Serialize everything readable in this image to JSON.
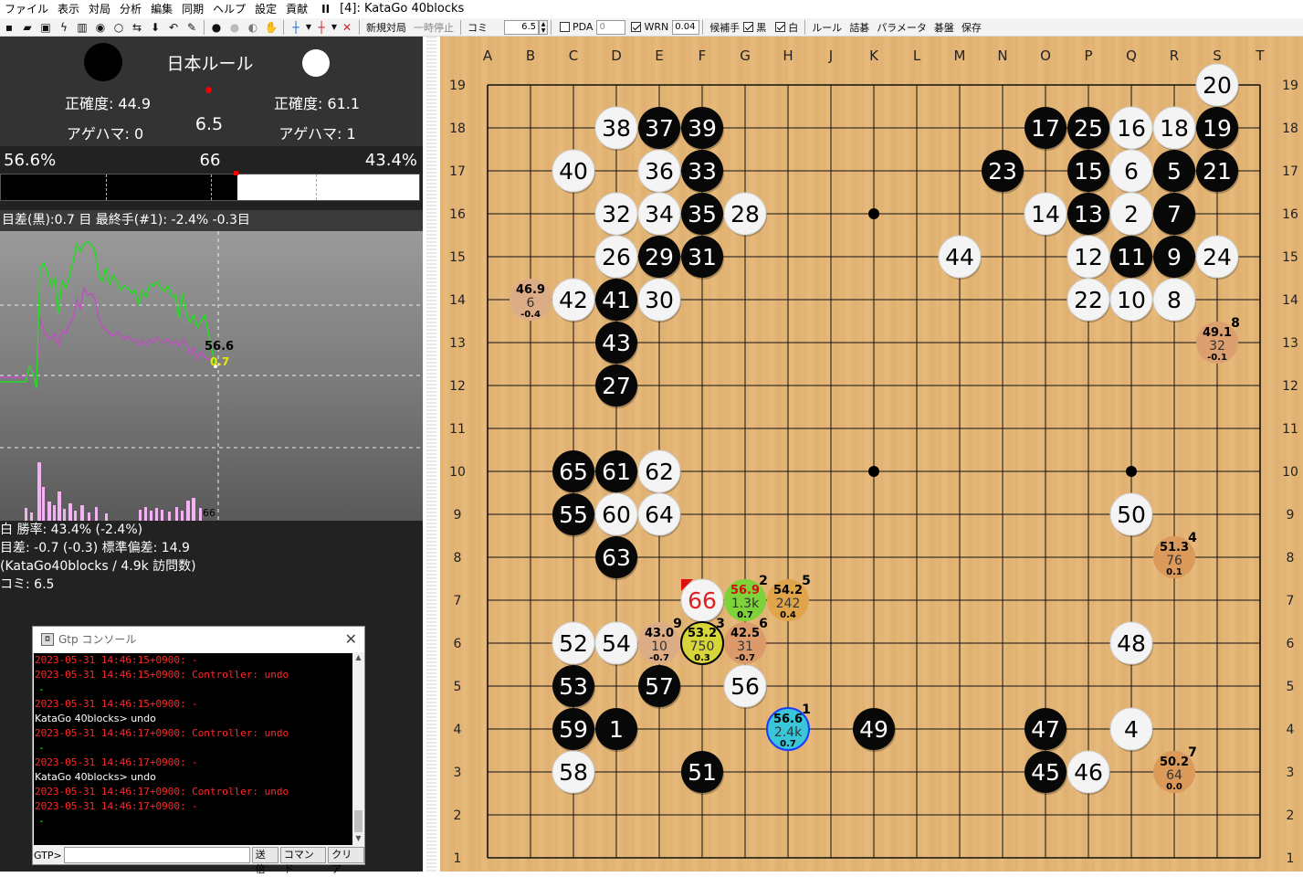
{
  "menu": {
    "items": [
      "ファイル",
      "表示",
      "対局",
      "分析",
      "編集",
      "同期",
      "ヘルプ",
      "設定",
      "貢献"
    ],
    "pause_symbol": "II",
    "window_title": "[4]: KataGo 40blocks"
  },
  "toolbar": {
    "new_game": "新規対局",
    "pause": "一時停止",
    "komi_label": "コミ",
    "komi_value": "6.5",
    "pda_label": "PDA",
    "pda_value": "0",
    "wrn_label": "WRN",
    "wrn_value": "0.04",
    "candidate_label": "候補手",
    "black_label": "黒",
    "white_label": "白",
    "rules": "ルール",
    "tsumego": "詰碁",
    "params": "パラメータ",
    "board": "碁盤",
    "save": "保存"
  },
  "score": {
    "rule": "日本ルール",
    "black_accuracy": "正確度: 44.9",
    "white_accuracy": "正確度: 61.1",
    "black_captures": "アゲハマ: 0",
    "white_captures": "アゲハマ: 1",
    "komi": "6.5"
  },
  "winrate": {
    "black_pct": "56.6%",
    "move_num": "66",
    "white_pct": "43.4%",
    "black_fraction": 0.566
  },
  "info_line": "目差(黒):0.7 目 最終手(#1): -2.4% -0.3目",
  "graph": {
    "last_winrate": "56.6",
    "last_score": "0.7",
    "last_move": "66"
  },
  "stats": [
    "白 勝率: 43.4% (-2.4%)",
    "目差: -0.7 (-0.3) 標準偏差: 14.9",
    "(KataGo40blocks / 4.9k 訪問数)",
    "コミ: 6.5"
  ],
  "console": {
    "title": "Gtp コンソール",
    "lines": [
      {
        "t": "red",
        "s": "2023-05-31 14:46:15+0900: -"
      },
      {
        "t": "red",
        "s": "2023-05-31 14:46:15+0900: Controller: undo"
      },
      {
        "t": "green",
        "s": "-"
      },
      {
        "t": "red",
        "s": "2023-05-31 14:46:15+0900: -"
      },
      {
        "t": "white",
        "s": "KataGo 40blocks> undo"
      },
      {
        "t": "red",
        "s": "2023-05-31 14:46:17+0900: Controller: undo"
      },
      {
        "t": "green",
        "s": "-"
      },
      {
        "t": "red",
        "s": "2023-05-31 14:46:17+0900: -"
      },
      {
        "t": "white",
        "s": "KataGo 40blocks> undo"
      },
      {
        "t": "red",
        "s": "2023-05-31 14:46:17+0900: Controller: undo"
      },
      {
        "t": "red",
        "s": "2023-05-31 14:46:17+0900: -"
      },
      {
        "t": "green",
        "s": "-"
      }
    ],
    "prompt": "GTP>",
    "send": "送信",
    "command": "コマンド",
    "clear": "クリア"
  },
  "board": {
    "cols": [
      "A",
      "B",
      "C",
      "D",
      "E",
      "F",
      "G",
      "H",
      "J",
      "K",
      "L",
      "M",
      "N",
      "O",
      "P",
      "Q",
      "R",
      "S",
      "T"
    ],
    "rows": [
      "19",
      "18",
      "17",
      "16",
      "15",
      "14",
      "13",
      "12",
      "11",
      "10",
      "9",
      "8",
      "7",
      "6",
      "5",
      "4",
      "3",
      "2",
      "1"
    ],
    "stones": [
      {
        "c": "S",
        "r": 19,
        "k": "w",
        "n": "20"
      },
      {
        "c": "D",
        "r": 18,
        "k": "w",
        "n": "38"
      },
      {
        "c": "E",
        "r": 18,
        "k": "b",
        "n": "37"
      },
      {
        "c": "F",
        "r": 18,
        "k": "b",
        "n": "39"
      },
      {
        "c": "O",
        "r": 18,
        "k": "b",
        "n": "17"
      },
      {
        "c": "P",
        "r": 18,
        "k": "b",
        "n": "25"
      },
      {
        "c": "Q",
        "r": 18,
        "k": "w",
        "n": "16"
      },
      {
        "c": "R",
        "r": 18,
        "k": "w",
        "n": "18"
      },
      {
        "c": "S",
        "r": 18,
        "k": "b",
        "n": "19"
      },
      {
        "c": "C",
        "r": 17,
        "k": "w",
        "n": "40"
      },
      {
        "c": "E",
        "r": 17,
        "k": "w",
        "n": "36"
      },
      {
        "c": "F",
        "r": 17,
        "k": "b",
        "n": "33"
      },
      {
        "c": "N",
        "r": 17,
        "k": "b",
        "n": "23"
      },
      {
        "c": "P",
        "r": 17,
        "k": "b",
        "n": "15"
      },
      {
        "c": "Q",
        "r": 17,
        "k": "w",
        "n": "6"
      },
      {
        "c": "R",
        "r": 17,
        "k": "b",
        "n": "5"
      },
      {
        "c": "S",
        "r": 17,
        "k": "b",
        "n": "21"
      },
      {
        "c": "D",
        "r": 16,
        "k": "w",
        "n": "32"
      },
      {
        "c": "E",
        "r": 16,
        "k": "w",
        "n": "34"
      },
      {
        "c": "F",
        "r": 16,
        "k": "b",
        "n": "35"
      },
      {
        "c": "G",
        "r": 16,
        "k": "w",
        "n": "28"
      },
      {
        "c": "O",
        "r": 16,
        "k": "w",
        "n": "14"
      },
      {
        "c": "P",
        "r": 16,
        "k": "b",
        "n": "13"
      },
      {
        "c": "Q",
        "r": 16,
        "k": "w",
        "n": "2"
      },
      {
        "c": "R",
        "r": 16,
        "k": "b",
        "n": "7"
      },
      {
        "c": "D",
        "r": 15,
        "k": "w",
        "n": "26"
      },
      {
        "c": "E",
        "r": 15,
        "k": "b",
        "n": "29"
      },
      {
        "c": "F",
        "r": 15,
        "k": "b",
        "n": "31"
      },
      {
        "c": "M",
        "r": 15,
        "k": "w",
        "n": "44"
      },
      {
        "c": "P",
        "r": 15,
        "k": "w",
        "n": "12"
      },
      {
        "c": "Q",
        "r": 15,
        "k": "b",
        "n": "11"
      },
      {
        "c": "R",
        "r": 15,
        "k": "b",
        "n": "9"
      },
      {
        "c": "S",
        "r": 15,
        "k": "w",
        "n": "24"
      },
      {
        "c": "C",
        "r": 14,
        "k": "w",
        "n": "42"
      },
      {
        "c": "D",
        "r": 14,
        "k": "b",
        "n": "41"
      },
      {
        "c": "E",
        "r": 14,
        "k": "w",
        "n": "30"
      },
      {
        "c": "P",
        "r": 14,
        "k": "w",
        "n": "22"
      },
      {
        "c": "Q",
        "r": 14,
        "k": "w",
        "n": "10"
      },
      {
        "c": "R",
        "r": 14,
        "k": "w",
        "n": "8"
      },
      {
        "c": "D",
        "r": 13,
        "k": "b",
        "n": "43"
      },
      {
        "c": "D",
        "r": 12,
        "k": "b",
        "n": "27"
      },
      {
        "c": "C",
        "r": 10,
        "k": "b",
        "n": "65"
      },
      {
        "c": "D",
        "r": 10,
        "k": "b",
        "n": "61"
      },
      {
        "c": "E",
        "r": 10,
        "k": "w",
        "n": "62"
      },
      {
        "c": "C",
        "r": 9,
        "k": "b",
        "n": "55"
      },
      {
        "c": "D",
        "r": 9,
        "k": "w",
        "n": "60"
      },
      {
        "c": "E",
        "r": 9,
        "k": "w",
        "n": "64"
      },
      {
        "c": "Q",
        "r": 9,
        "k": "w",
        "n": "50"
      },
      {
        "c": "D",
        "r": 8,
        "k": "b",
        "n": "63"
      },
      {
        "c": "F",
        "r": 7,
        "k": "w",
        "n": "66",
        "last": true
      },
      {
        "c": "C",
        "r": 6,
        "k": "w",
        "n": "52"
      },
      {
        "c": "D",
        "r": 6,
        "k": "w",
        "n": "54"
      },
      {
        "c": "Q",
        "r": 6,
        "k": "w",
        "n": "48"
      },
      {
        "c": "C",
        "r": 5,
        "k": "b",
        "n": "53"
      },
      {
        "c": "E",
        "r": 5,
        "k": "b",
        "n": "57"
      },
      {
        "c": "G",
        "r": 5,
        "k": "w",
        "n": "56"
      },
      {
        "c": "C",
        "r": 4,
        "k": "b",
        "n": "59"
      },
      {
        "c": "D",
        "r": 4,
        "k": "b",
        "n": "1"
      },
      {
        "c": "K",
        "r": 4,
        "k": "b",
        "n": "49"
      },
      {
        "c": "O",
        "r": 4,
        "k": "b",
        "n": "47"
      },
      {
        "c": "Q",
        "r": 4,
        "k": "w",
        "n": "4"
      },
      {
        "c": "C",
        "r": 3,
        "k": "w",
        "n": "58"
      },
      {
        "c": "F",
        "r": 3,
        "k": "b",
        "n": "51"
      },
      {
        "c": "O",
        "r": 3,
        "k": "b",
        "n": "45"
      },
      {
        "c": "P",
        "r": 3,
        "k": "w",
        "n": "46"
      }
    ],
    "candidates": [
      {
        "c": "H",
        "r": 4,
        "wr": "56.6",
        "v": "2.4k",
        "s": "0.7",
        "rank": "1",
        "color": "#38c6d8",
        "ring": "#1a3cff"
      },
      {
        "c": "G",
        "r": 7,
        "wr": "56.9",
        "v": "1.3k",
        "s": "0.7",
        "rank": "2",
        "color": "#7ed23a",
        "wrcolor": "#d01010"
      },
      {
        "c": "F",
        "r": 6,
        "wr": "53.2",
        "v": "750",
        "s": "0.3",
        "rank": "3",
        "color": "#d6d63a",
        "ring": "#000000"
      },
      {
        "c": "R",
        "r": 8,
        "wr": "51.3",
        "v": "76",
        "s": "0.1",
        "rank": "4",
        "color": "#dc9a5a"
      },
      {
        "c": "H",
        "r": 7,
        "wr": "54.2",
        "v": "242",
        "s": "0.4",
        "rank": "5",
        "color": "#e0a54a"
      },
      {
        "c": "G",
        "r": 6,
        "wr": "42.5",
        "v": "31",
        "s": "-0.7",
        "rank": "6",
        "color": "#dc9a6a"
      },
      {
        "c": "R",
        "r": 3,
        "wr": "50.2",
        "v": "64",
        "s": "0.0",
        "rank": "7",
        "color": "#dc9a5a"
      },
      {
        "c": "S",
        "r": 13,
        "wr": "49.1",
        "v": "32",
        "s": "-0.1",
        "rank": "8",
        "color": "#dca070"
      },
      {
        "c": "E",
        "r": 6,
        "wr": "43.0",
        "v": "10",
        "s": "-0.7",
        "rank": "9",
        "color": "#dcac86"
      },
      {
        "c": "B",
        "r": 14,
        "wr": "46.9",
        "v": "6",
        "s": "-0.4",
        "rank": "",
        "color": "#dcac86"
      }
    ]
  }
}
